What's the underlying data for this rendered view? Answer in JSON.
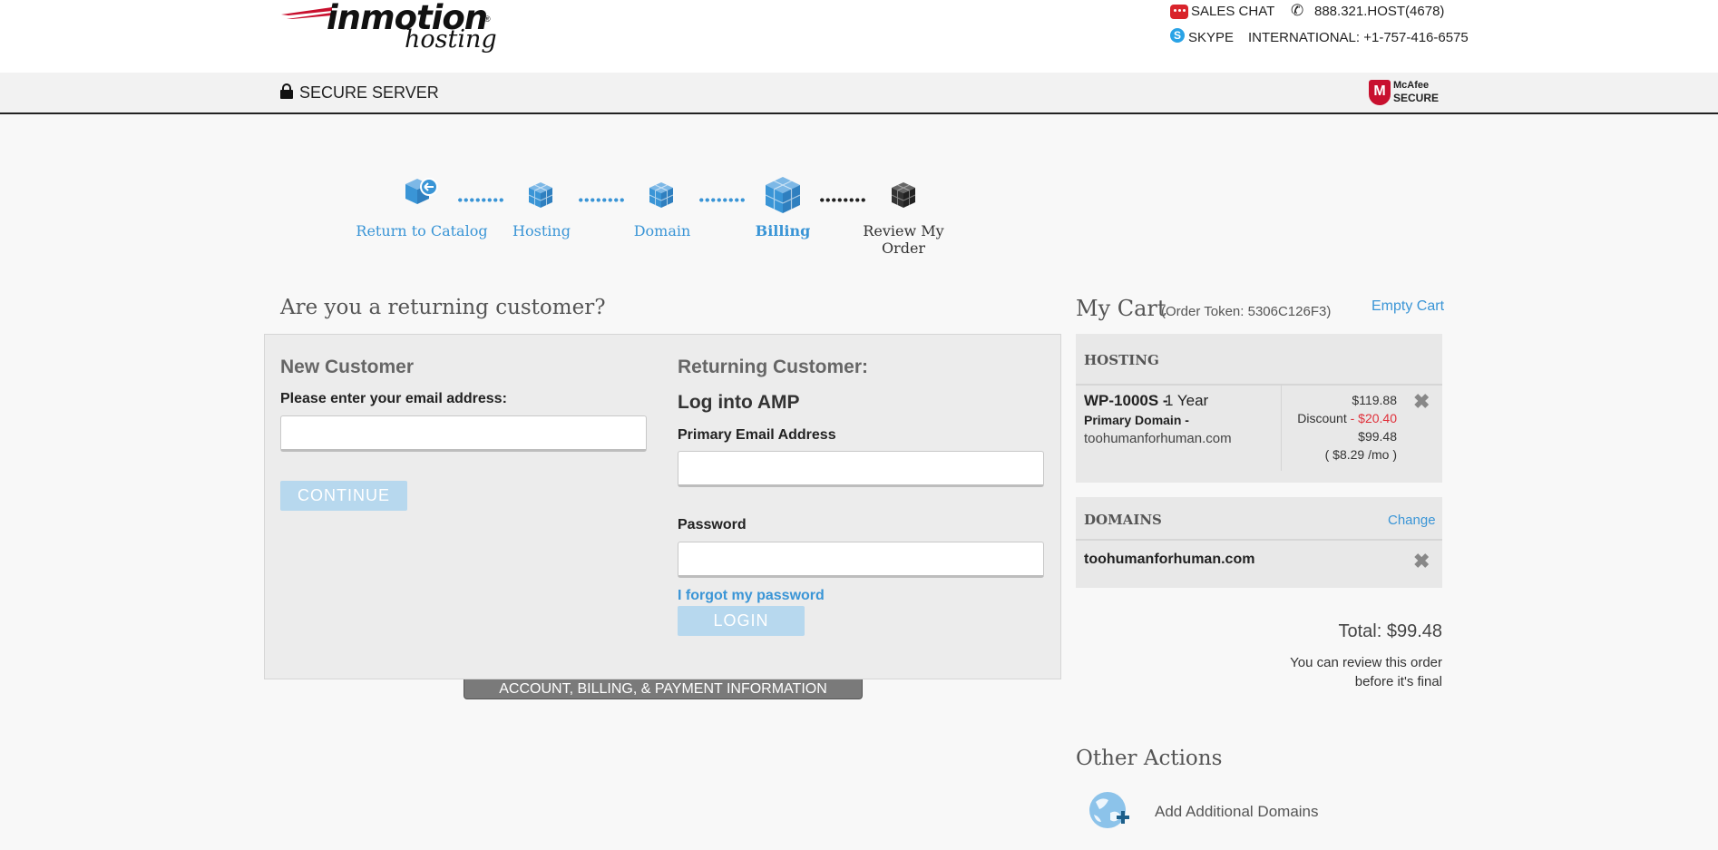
{
  "header": {
    "logo_main": "inmotion",
    "logo_sub": "hosting",
    "logo_reg": "®",
    "sales_chat": "SALES CHAT",
    "phone": "888.321.HOST(4678)",
    "skype": "SKYPE",
    "international": "INTERNATIONAL: +1-757-416-6575",
    "secure_server": "SECURE SERVER",
    "mcafee_line1": "McAfee",
    "mcafee_line2": "SECURE"
  },
  "steps": [
    {
      "label": "Return to Catalog"
    },
    {
      "label": "Hosting"
    },
    {
      "label": "Domain"
    },
    {
      "label": "Billing"
    },
    {
      "label": "Review My Order"
    }
  ],
  "login": {
    "heading": "Are you a returning customer?",
    "new_title": "New Customer",
    "new_prompt": "Please enter your email address:",
    "new_email_value": "",
    "continue_label": "CONTINUE",
    "returning_title": "Returning Customer:",
    "amp_title": "Log into AMP",
    "email_label": "Primary Email Address",
    "email_value": "",
    "password_label": "Password",
    "password_value": "",
    "forgot_label": "I forgot my password",
    "login_label": "LOGIN",
    "section_tab": "ACCOUNT, BILLING, & PAYMENT INFORMATION"
  },
  "cart": {
    "title": "My Cart",
    "token": "(Order Token: 5306C126F3)",
    "empty_label": "Empty Cart",
    "hosting": {
      "header": "HOSTING",
      "plan": "WP-1000S -",
      "term": "1 Year",
      "primary_label": "Primary Domain -",
      "domain": "toohumanforhuman.com",
      "price": "$119.88",
      "discount_label": "Discount",
      "discount_value": "- $20.40",
      "net": "$99.48",
      "monthly": "( $8.29 /mo )"
    },
    "domains": {
      "header": "DOMAINS",
      "change_label": "Change",
      "domain": "toohumanforhuman.com"
    },
    "total": "Total: $99.48",
    "review_note_1": "You can review this order",
    "review_note_2": "before it's final"
  },
  "other_actions": {
    "title": "Other Actions",
    "items": [
      {
        "label": "Add Additional Domains"
      }
    ]
  },
  "colors": {
    "accent": "#3a95d6",
    "discount": "#e0303a",
    "button": "#b7d8ee"
  }
}
